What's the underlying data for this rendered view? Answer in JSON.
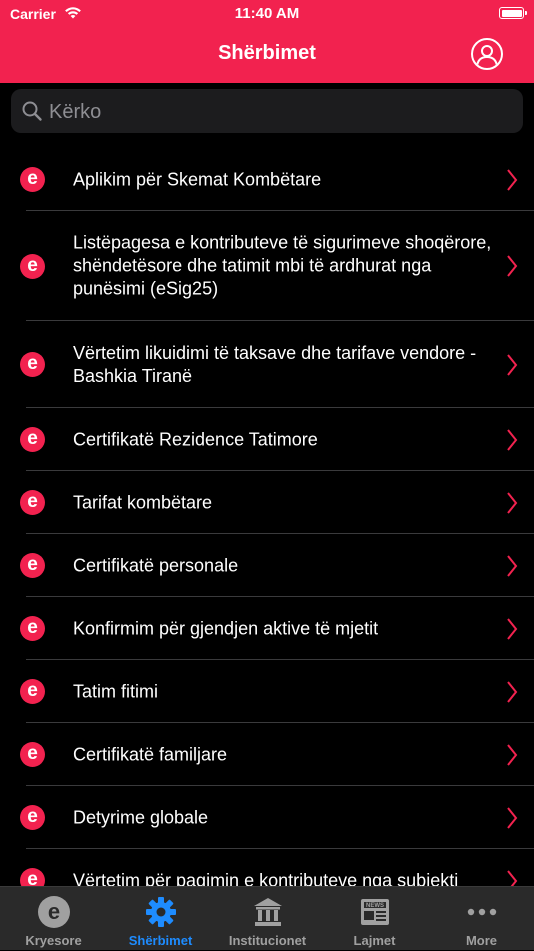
{
  "status_bar": {
    "carrier": "Carrier",
    "time": "11:40 AM"
  },
  "header": {
    "title": "Shërbimet"
  },
  "search": {
    "placeholder": "Kërko"
  },
  "colors": {
    "brand": "#f2224f",
    "active_tab": "#1e8cff",
    "inactive_tab": "#a0a0a0"
  },
  "services": [
    {
      "label": "Aplikim për Skemat Kombëtare",
      "logo": "e"
    },
    {
      "label": "Listëpagesa e kontributeve të sigurimeve shoqërore, shëndetësore dhe tatimit mbi të ardhurat nga punësimi (eSig25)",
      "logo": "e"
    },
    {
      "label": "Vërtetim likuidimi të taksave dhe tarifave vendore - Bashkia Tiranë",
      "logo": "e"
    },
    {
      "label": "Certifikatë Rezidence Tatimore",
      "logo": "e"
    },
    {
      "label": "Tarifat kombëtare",
      "logo": "e"
    },
    {
      "label": "Certifikatë personale",
      "logo": "e"
    },
    {
      "label": "Konfirmim për gjendjen aktive të mjetit",
      "logo": "e"
    },
    {
      "label": "Tatim fitimi",
      "logo": "e"
    },
    {
      "label": "Certifikatë familjare",
      "logo": "e"
    },
    {
      "label": "Detyrime globale",
      "logo": "e"
    },
    {
      "label": "Vërtetim për pagimin e kontributeve nga subjekti",
      "logo": "e"
    }
  ],
  "tabbar": {
    "kryesore": "Kryesore",
    "sherbimet": "Shërbimet",
    "institucionet": "Institucionet",
    "lajmet": "Lajmet",
    "more": "More",
    "news_glyph": "NEWS",
    "e_glyph": "e"
  }
}
